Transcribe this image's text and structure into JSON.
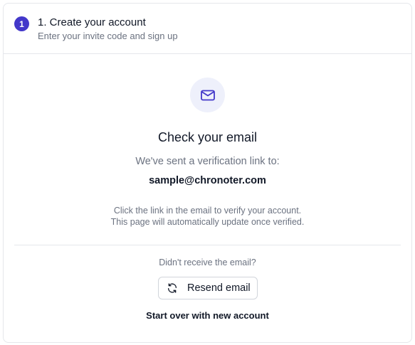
{
  "step": {
    "number": "1",
    "title": "1. Create your account",
    "subtitle": "Enter your invite code and sign up"
  },
  "check_email": {
    "icon": "mail-icon",
    "title": "Check your email",
    "sent_text": "We've sent a verification link to:",
    "email": "sample@chronoter.com",
    "info_line1": "Click the link in the email to verify your account.",
    "info_line2": "This page will automatically update once verified."
  },
  "resend": {
    "prompt": "Didn't receive the email?",
    "button_label": "Resend email",
    "icon": "refresh-icon"
  },
  "start_over_label": "Start over with new account",
  "colors": {
    "accent": "#4338ca",
    "icon_bg": "#eef0fb",
    "muted_text": "#6b7280",
    "border": "#e5e7eb"
  }
}
